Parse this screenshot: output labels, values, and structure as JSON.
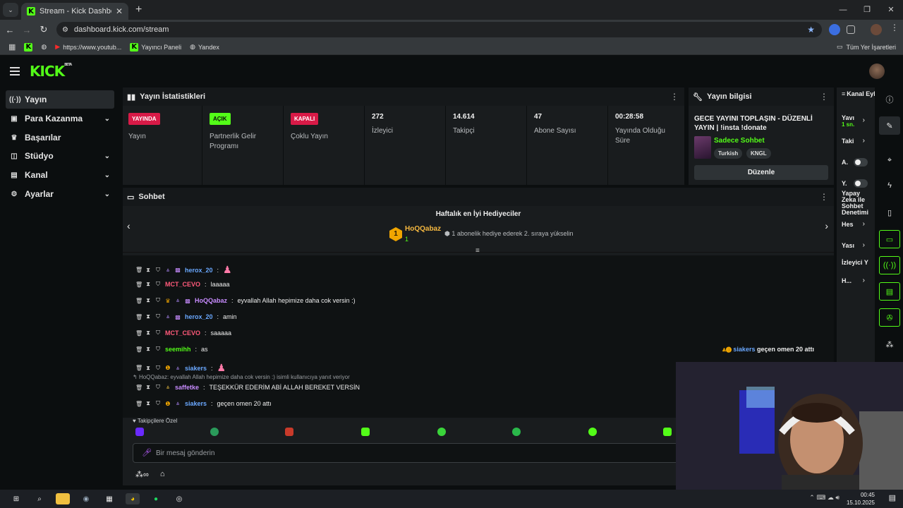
{
  "browser": {
    "tab_title": "Stream - Kick Dashboard",
    "url": "dashboard.kick.com/stream",
    "bookmarks": [
      "https://www.youtub...",
      "Yayıncı Paneli",
      "Yandex"
    ],
    "all_bookmarks": "Tüm Yer İşaretleri"
  },
  "sidebar": {
    "items": [
      {
        "label": "Yayın",
        "icon": "broadcast-icon",
        "active": true
      },
      {
        "label": "Para Kazanma",
        "icon": "money-icon"
      },
      {
        "label": "Başarılar",
        "icon": "trophy-icon"
      },
      {
        "label": "Stüdyo",
        "icon": "studio-icon"
      },
      {
        "label": "Kanal",
        "icon": "channel-icon"
      },
      {
        "label": "Ayarlar",
        "icon": "gear-icon"
      }
    ]
  },
  "stats": {
    "title": "Yayın İstatistikleri",
    "cells": [
      {
        "badge": "YAYINDA",
        "label": "Yayın"
      },
      {
        "badge": "AÇIK",
        "label": "Partnerlik Gelir Programı"
      },
      {
        "badge": "KAPALI",
        "label": "Çoklu Yayın"
      },
      {
        "value": "272",
        "label": "İzleyici"
      },
      {
        "value": "14.614",
        "label": "Takipçi"
      },
      {
        "value": "47",
        "label": "Abone Sayısı"
      },
      {
        "value": "00:28:58",
        "label": "Yayında Olduğu Süre"
      }
    ]
  },
  "stream_info": {
    "title": "Yayın bilgisi",
    "stream_title": "GECE YAYINI TOPLAŞIN - DÜZENLİ YAYIN | !insta !donate",
    "category": "Sadece Sohbet",
    "tags": [
      "Turkish",
      "KNGL"
    ],
    "edit": "Düzenle"
  },
  "channel_actions": {
    "title": "Kanal Eylemleri",
    "rows": [
      "Yavı",
      "1 sn.",
      "Taki",
      "A.",
      "Y.",
      "Yapay Zeka ile Sohbet Denetimi",
      "Hes",
      "Yası",
      "İzleyici Y",
      "H..."
    ]
  },
  "chat": {
    "title": "Sohbet",
    "gifters_title": "Haftalık en İyi Hediyeciler",
    "top_gifter": {
      "rank": "1",
      "name": "HoQQabaz",
      "count": "1",
      "note": "1 abonelik hediye ederek 2. sıraya yükselin"
    },
    "messages": [
      {
        "user": "herox_20",
        "text": "",
        "color": "#6aa8ff"
      },
      {
        "user": "MCT_CEVO",
        "text": "laaaaa",
        "color": "#ff5a7a"
      },
      {
        "user": "HoQQabaz",
        "text": "eyvallah Allah hepimize daha cok versin :)",
        "color": "#c88cff"
      },
      {
        "user": "herox_20",
        "text": "amin",
        "color": "#6aa8ff"
      },
      {
        "user": "MCT_CEVO",
        "text": "saaaaa",
        "color": "#ff5a7a"
      },
      {
        "user": "seemihh",
        "text": "as",
        "color": "#53fc18"
      },
      {
        "user": "siakers",
        "text": "",
        "color": "#6aa8ff"
      },
      {
        "user": "saffetke",
        "text": "TEŞEKKÜR EDERİM ABİ ALLAH BEREKET VERSİN",
        "color": "#c88cff"
      },
      {
        "user": "siakers",
        "text": "geçen omen 20 attı",
        "color": "#6aa8ff"
      }
    ],
    "reply_note": "HoQQabaz: eyvallah Allah hepimize daha cok versin :) isimli kullanıcıya yanıt veriyor",
    "pinned_user": "siakers",
    "pinned_text": "geçen omen 20 attı",
    "followers_only": "Takipçilere Özel",
    "input_placeholder": "Bir mesaj gönderin"
  },
  "taskbar": {
    "time": "00:45",
    "date": "15.10.2025"
  }
}
